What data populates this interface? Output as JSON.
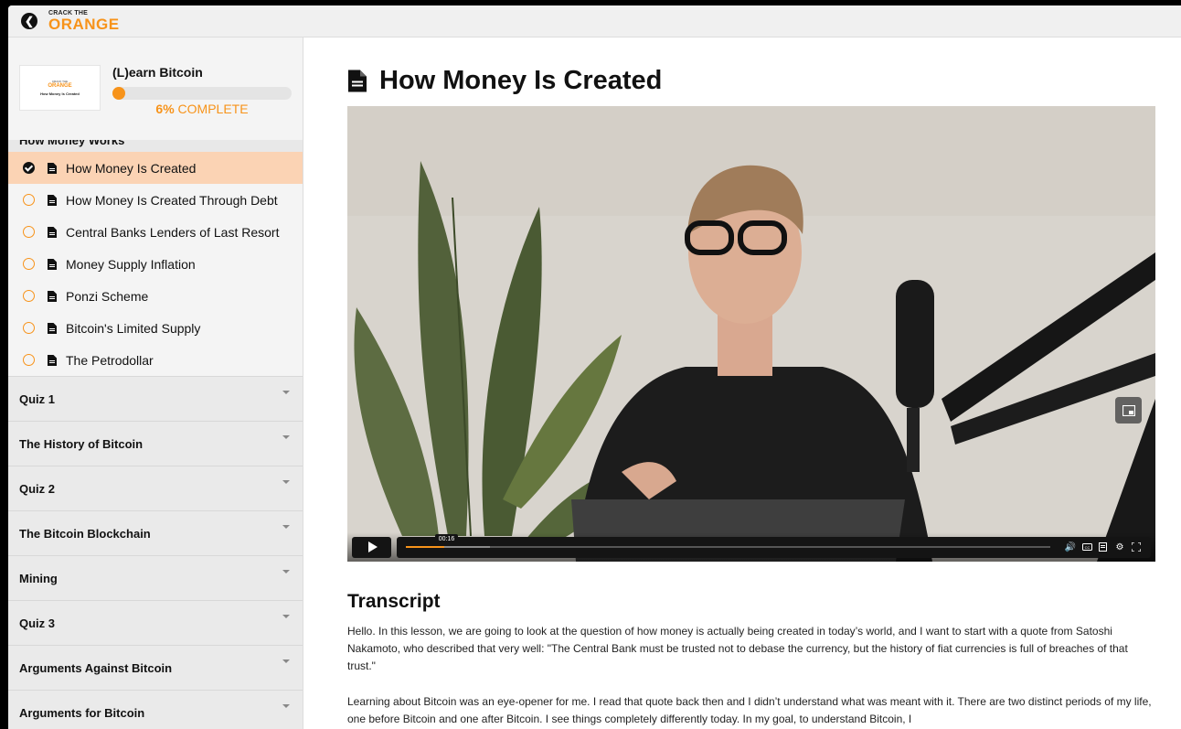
{
  "topbar": {
    "logo_small": "CRACK THE",
    "logo_big": "ORANGE",
    "back_icon": "circle-chevron-left-icon"
  },
  "course": {
    "thumb_small": "CRACK THE",
    "thumb_orange": "ORANGE",
    "thumb_title": "How Money Is Created",
    "title": "(L)earn Bitcoin",
    "progress_percent": 6,
    "progress_pct_label": "6%",
    "progress_label": "COMPLETE"
  },
  "sidebar": {
    "section_title": "How Money Works",
    "lessons": [
      {
        "label": "How Money Is Created",
        "completed": true,
        "active": true
      },
      {
        "label": "How Money Is Created Through Debt",
        "completed": false
      },
      {
        "label": "Central Banks Lenders of Last Resort",
        "completed": false
      },
      {
        "label": "Money Supply Inflation",
        "completed": false
      },
      {
        "label": "Ponzi Scheme",
        "completed": false
      },
      {
        "label": "Bitcoin's Limited Supply",
        "completed": false
      },
      {
        "label": "The Petrodollar",
        "completed": false
      }
    ],
    "modules": [
      "Quiz 1",
      "The History of Bitcoin",
      "Quiz 2",
      "The Bitcoin Blockchain",
      "Mining",
      "Quiz 3",
      "Arguments Against Bitcoin",
      "Arguments for Bitcoin"
    ]
  },
  "main": {
    "title": "How Money Is Created",
    "video": {
      "current_time": "00:16",
      "progress_fraction": 0.06,
      "buffered_fraction": 0.13
    },
    "transcript_title": "Transcript",
    "paragraphs": [
      "Hello. In this lesson, we are going to look at the question of how money is actually being created in today’s world, and I want to start with a quote from Satoshi Nakamoto, who described that very well: \"The Central Bank must be trusted not to debase the currency, but the history of fiat currencies is full of breaches of that trust.\"",
      "Learning about Bitcoin was an eye-opener for me. I read that quote back then and I didn’t understand what was meant with it. There are two distinct periods of my life, one before Bitcoin and one after Bitcoin. I see things completely differently today. In my goal, to understand Bitcoin, I"
    ]
  },
  "colors": {
    "accent": "#f7931a",
    "active_lesson_bg": "#fbd3b4"
  }
}
